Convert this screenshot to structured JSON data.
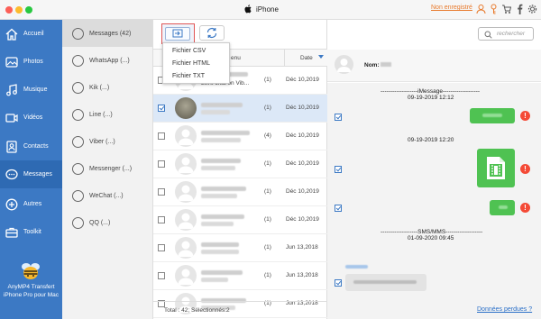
{
  "titlebar": {
    "title": "iPhone",
    "registered_label": "Non enregistré",
    "icons": [
      "apple-icon",
      "user-icon",
      "key-icon",
      "cart-icon",
      "facebook-icon",
      "settings-icon"
    ]
  },
  "sidebar": {
    "items": [
      {
        "label": "Accueil",
        "icon": "home-icon",
        "active": false
      },
      {
        "label": "Photos",
        "icon": "photos-icon",
        "active": false
      },
      {
        "label": "Musique",
        "icon": "music-icon",
        "active": false
      },
      {
        "label": "Vidéos",
        "icon": "videos-icon",
        "active": false
      },
      {
        "label": "Contacts",
        "icon": "contacts-icon",
        "active": false
      },
      {
        "label": "Messages",
        "icon": "messages-icon",
        "active": true
      },
      {
        "label": "Autres",
        "icon": "others-icon",
        "active": false
      },
      {
        "label": "Toolkit",
        "icon": "toolkit-icon",
        "active": false
      }
    ],
    "brand_line1": "AnyMP4 Transfert",
    "brand_line2": "iPhone Pro pour Mac",
    "accent": "#3c79c4"
  },
  "apps": {
    "items": [
      {
        "label": "Messages (42)",
        "active": true
      },
      {
        "label": "WhatsApp (...)",
        "active": false
      },
      {
        "label": "Kik (...)",
        "active": false
      },
      {
        "label": "Line (...)",
        "active": false
      },
      {
        "label": "Viber (...)",
        "active": false
      },
      {
        "label": "Messenger (...)",
        "active": false
      },
      {
        "label": "WeChat (...)",
        "active": false
      },
      {
        "label": "QQ (...)",
        "active": false
      }
    ]
  },
  "list": {
    "export_menu": [
      "Fichier CSV",
      "Fichier HTML",
      "Fichier TXT"
    ],
    "col_content_suffix": "enu",
    "col_date": "Date",
    "rows": [
      {
        "snippet": "Let's chat on Vib...",
        "count": "(1)",
        "date": "Déc 10,2019",
        "checked": false,
        "selected": false,
        "photo": false
      },
      {
        "snippet": "",
        "count": "(1)",
        "date": "Déc 10,2019",
        "checked": true,
        "selected": true,
        "photo": true
      },
      {
        "snippet": "",
        "count": "(4)",
        "date": "Déc 10,2019",
        "checked": false,
        "selected": false,
        "photo": false
      },
      {
        "snippet": "",
        "count": "(1)",
        "date": "Déc 10,2019",
        "checked": false,
        "selected": false,
        "photo": false
      },
      {
        "snippet": "",
        "count": "(1)",
        "date": "Déc 10,2019",
        "checked": false,
        "selected": false,
        "photo": false
      },
      {
        "snippet": "",
        "count": "(1)",
        "date": "Déc 10,2019",
        "checked": false,
        "selected": false,
        "photo": false
      },
      {
        "snippet": "",
        "count": "(1)",
        "date": "Jun 13,2018",
        "checked": false,
        "selected": false,
        "photo": false
      },
      {
        "snippet": "",
        "count": "(1)",
        "date": "Jun 13,2018",
        "checked": false,
        "selected": false,
        "photo": false
      },
      {
        "snippet": "",
        "count": "(1)",
        "date": "Jun 13,2018",
        "checked": false,
        "selected": false,
        "photo": false
      }
    ],
    "footer": "Total : 42; Sélectionnés:2"
  },
  "detail": {
    "search_placeholder": "rechercher",
    "name_label": "Nom:",
    "imessage_sep": "-------------------iMessage-------------------",
    "date1": "09-19-2019 12:12",
    "date2": "09-19-2019 12:20",
    "sms_sep": "-------------------SMS/MMS-------------------",
    "date3": "01-09-2020 09:45",
    "error_mark": "!",
    "lost_link": "Données perdues ?",
    "bubble_color": "#4fc252",
    "error_color": "#f44a36"
  }
}
